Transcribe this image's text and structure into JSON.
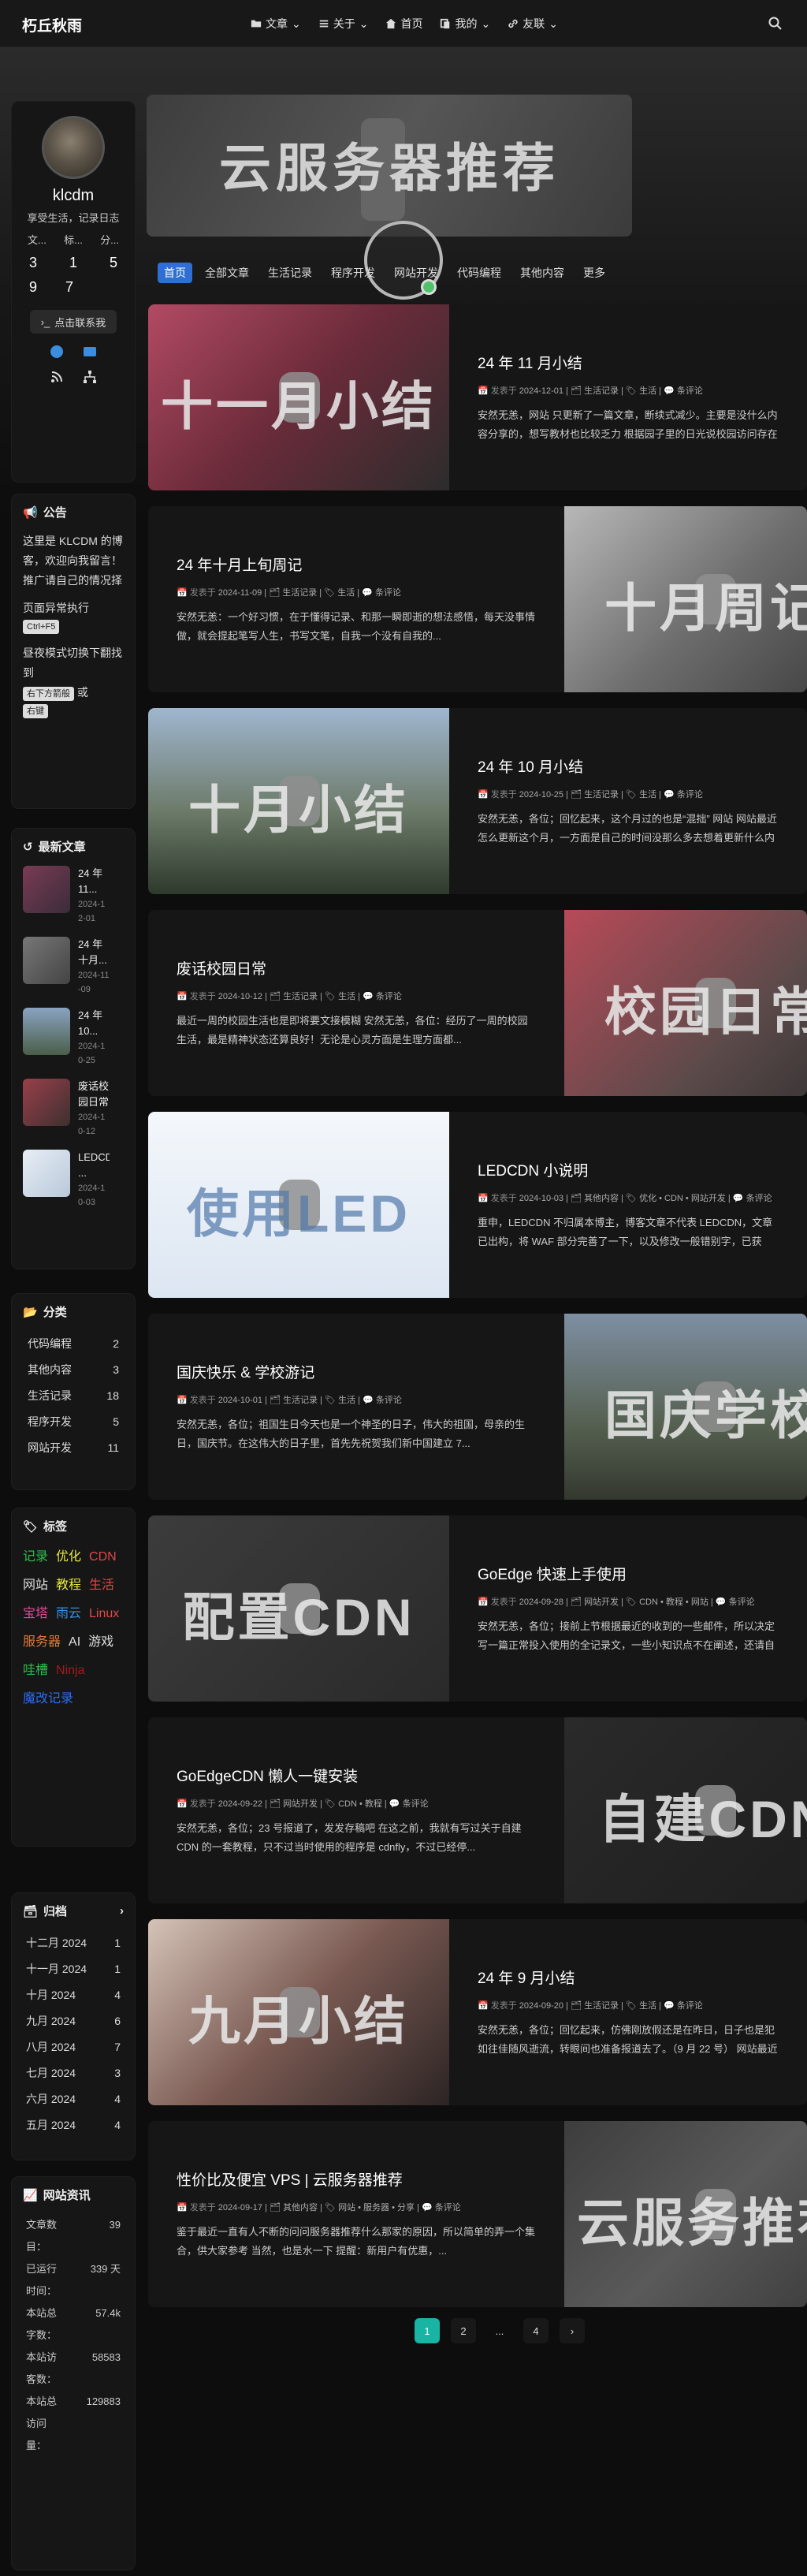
{
  "header": {
    "brand": "朽丘秋雨",
    "nav": [
      {
        "label": "文章",
        "icon": "folder-icon"
      },
      {
        "label": "关于",
        "icon": "list-icon"
      },
      {
        "label": "首页",
        "icon": "home-icon"
      },
      {
        "label": "我的",
        "icon": "copy-icon"
      },
      {
        "label": "友联",
        "icon": "link-icon"
      }
    ]
  },
  "profile": {
    "name": "klcdm",
    "description": "享受生活，记录日志",
    "stat_labels": [
      "文...",
      "标...",
      "分..."
    ],
    "stat_values": [
      "3",
      "1",
      "5",
      "9",
      "7"
    ],
    "contact_label": "点击联系我"
  },
  "notice": {
    "title": "公告",
    "text": "这里是 KLCDM 的博客，欢迎向我留言！推广请自己的情况择",
    "exec_label": "页面异常执行",
    "key": "Ctrl+F5",
    "mode_text": "昼夜模式切换下翻找到",
    "mode_a": "右下方箭般",
    "mode_or": "或",
    "mode_b": "右键"
  },
  "recent": {
    "title": "最新文章",
    "items": [
      {
        "title": "24 年 11...",
        "date": "2024-12-01"
      },
      {
        "title": "24 年十月...",
        "date": "2024-11-09"
      },
      {
        "title": "24 年 10...",
        "date": "2024-10-25"
      },
      {
        "title": "废话校园日常",
        "date": "2024-10-12"
      },
      {
        "title": "LEDCDN ...",
        "date": "2024-10-03"
      }
    ]
  },
  "categories": {
    "title": "分类",
    "items": [
      {
        "name": "代码编程",
        "count": "2"
      },
      {
        "name": "其他内容",
        "count": "3"
      },
      {
        "name": "生活记录",
        "count": "18"
      },
      {
        "name": "程序开发",
        "count": "5"
      },
      {
        "name": "网站开发",
        "count": "11"
      }
    ]
  },
  "tags": {
    "title": "标签",
    "items": [
      {
        "name": "记录",
        "color": "#2bbf4a"
      },
      {
        "name": "优化",
        "color": "#e5e545"
      },
      {
        "name": "CDN",
        "color": "#e04848"
      },
      {
        "name": "网站",
        "color": "#dddddd"
      },
      {
        "name": "教程",
        "color": "#e5e545"
      },
      {
        "name": "生活",
        "color": "#e04848"
      },
      {
        "name": "宝塔",
        "color": "#e0489a"
      },
      {
        "name": "雨云",
        "color": "#3a8ee0"
      },
      {
        "name": "Linux",
        "color": "#e04848"
      },
      {
        "name": "服务器",
        "color": "#e07a3a"
      },
      {
        "name": "AI",
        "color": "#dddddd"
      },
      {
        "name": "游戏",
        "color": "#dddddd"
      },
      {
        "name": "哇槽",
        "color": "#2bbf4a"
      },
      {
        "name": "Ninja",
        "color": "#a01c1c"
      },
      {
        "name": "魔改记录",
        "color": "#2b6ef0"
      }
    ]
  },
  "archive": {
    "title": "归档",
    "items": [
      {
        "month": "十二月 2024",
        "count": "1"
      },
      {
        "month": "十一月 2024",
        "count": "1"
      },
      {
        "month": "十月 2024",
        "count": "4"
      },
      {
        "month": "九月 2024",
        "count": "6"
      },
      {
        "month": "八月 2024",
        "count": "7"
      },
      {
        "month": "七月 2024",
        "count": "3"
      },
      {
        "month": "六月 2024",
        "count": "4"
      },
      {
        "month": "五月 2024",
        "count": "4"
      }
    ]
  },
  "site_info": {
    "title": "网站资讯",
    "rows": [
      {
        "label": "文章数目：",
        "value": "39"
      },
      {
        "label": "已运行时间：",
        "value": "339 天"
      },
      {
        "label": "本站总字数：",
        "value": "57.4k"
      },
      {
        "label": "本站访客数：",
        "value": "58583"
      },
      {
        "label": "本站总访问量：",
        "value": "129883"
      }
    ]
  },
  "banner": {
    "text": "云服务器推荐"
  },
  "tabs": [
    "首页",
    "全部文章",
    "生活记录",
    "程序开发",
    "网站开发",
    "代码编程",
    "其他内容",
    "更多"
  ],
  "posts": [
    {
      "title": "24 年 11 月小结",
      "date": "2024-12-01",
      "category": "生活记录",
      "tags": "生活",
      "comments": "条评论",
      "excerpt": "安然无恙，网站 只更新了一篇文章，断续式减少。主要是没什么内容分享的，想写教材也比较乏力 根据园子里的日光说校园访问存在问题...",
      "thumb_text": "十一月小结",
      "thumb_side": "left"
    },
    {
      "title": "24 年十月上旬周记",
      "date": "2024-11-09",
      "category": "生活记录",
      "tags": "生活",
      "comments": "条评论",
      "excerpt": "安然无恙：一个好习惯，在于懂得记录、和那一瞬即逝的想法感悟，每天没事情做，就会提起笔写人生，书写文笔，自我一个没有自我的...",
      "thumb_text": "十月周记",
      "thumb_side": "right"
    },
    {
      "title": "24 年 10 月小结",
      "date": "2024-10-25",
      "category": "生活记录",
      "tags": "生活",
      "comments": "条评论",
      "excerpt": "安然无恙，各位；回忆起来，这个月过的也是“混拙” 网站 网站最近怎么更新这个月，一方面是自己的时间没那么多去想着更新什么内容...",
      "thumb_text": "十月小结",
      "thumb_side": "left"
    },
    {
      "title": "废话校园日常",
      "date": "2024-10-12",
      "category": "生活记录",
      "tags": "生活",
      "comments": "条评论",
      "excerpt": "最近一周的校园生活也是即将要文接模糊 安然无恙，各位：经历了一周的校园生活，最是精神状态还算良好！无论是心灵方面是生理方面都...",
      "thumb_text": "校园日常",
      "thumb_side": "right"
    },
    {
      "title": "LEDCDN 小说明",
      "date": "2024-10-03",
      "category": "其他内容",
      "tags": "优化 • CDN • 网站开发",
      "comments": "条评论",
      "excerpt": "重申，LEDCDN 不归属本博主，博客文章不代表 LEDCDN，文章已出构，将 WAF 部分完善了一下，以及修改一般错别字，已获稿，LED...",
      "thumb_text": "使用LED",
      "thumb_side": "left"
    },
    {
      "title": "国庆快乐 & 学校游记",
      "date": "2024-10-01",
      "category": "生活记录",
      "tags": "生活",
      "comments": "条评论",
      "excerpt": "安然无恙，各位；祖国生日今天也是一个神圣的日子，伟大的祖国，母亲的生日，国庆节。在这伟大的日子里，首先先祝贺我们新中国建立 7...",
      "thumb_text": "国庆学校",
      "thumb_side": "right"
    },
    {
      "title": "GoEdge 快速上手使用",
      "date": "2024-09-28",
      "category": "网站开发",
      "tags": "CDN • 教程 • 网站",
      "comments": "条评论",
      "excerpt": "安然无恙，各位；接前上节根据最近的收到的一些邮件，所以决定写一篇正常投入使用的全记录文，一些小知识点不在阐述，还请自行根据...",
      "thumb_text": "配置CDN",
      "thumb_side": "left"
    },
    {
      "title": "GoEdgeCDN 懒人一键安装",
      "date": "2024-09-22",
      "category": "网站开发",
      "tags": "CDN • 教程",
      "comments": "条评论",
      "excerpt": "安然无恙，各位；23 号报道了，发发存稿吧 在这之前，我就有写过关于自建 CDN 的一套教程，只不过当时使用的程序是 cdnfly，不过已经停...",
      "thumb_text": "自建CDN",
      "thumb_side": "right"
    },
    {
      "title": "24 年 9 月小结",
      "date": "2024-09-20",
      "category": "生活记录",
      "tags": "生活",
      "comments": "条评论",
      "excerpt": "安然无恙，各位；回忆起来，仿佛刚放假还是在昨日，日子也是犯如往佳随风逝流，转眼间也准备报道去了。（9 月 22 号） 网站最近已经...",
      "thumb_text": "九月小结",
      "thumb_side": "left"
    },
    {
      "title": "性价比及便宜 VPS | 云服务器推荐",
      "date": "2024-09-17",
      "category": "其他内容",
      "tags": "网站 • 服务器 • 分享",
      "comments": "条评论",
      "excerpt": "鉴于最近一直有人不断的问问服务器推荐什么那家的原因，所以简单的弄一个集合，供大家参考 当然，也是水一下 提醒：新用户有优惠，...",
      "thumb_text": "云服务推荐",
      "thumb_side": "right"
    }
  ],
  "pagination": [
    "1",
    "2",
    "...",
    "4",
    "›"
  ],
  "colors": {
    "accent": "#2f6fd3",
    "page_active": "#18b5a4",
    "notice_red": "#e04848"
  }
}
